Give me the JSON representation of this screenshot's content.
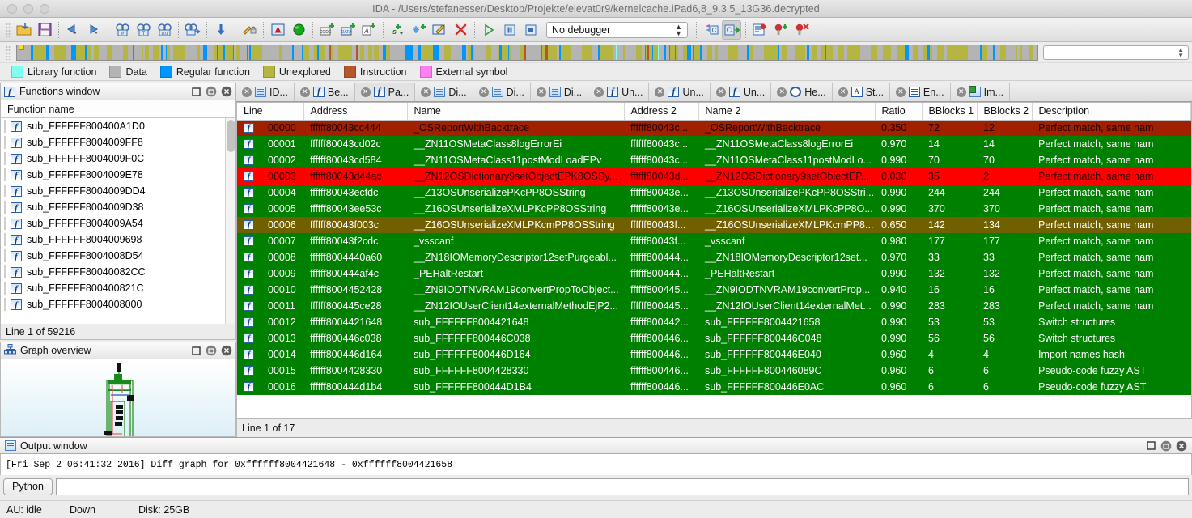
{
  "window": {
    "title": "IDA - /Users/stefanesser/Desktop/Projekte/elevat0r9/kernelcache.iPad6,8_9.3.5_13G36.decrypted"
  },
  "toolbar": {
    "debugger_select": "No debugger",
    "buttons": [
      {
        "name": "open-file-icon"
      },
      {
        "name": "save-icon"
      },
      {
        "name": "navigate-back-icon"
      },
      {
        "name": "navigate-forward-icon"
      },
      {
        "name": "jump-to-address-icon"
      },
      {
        "name": "jump-to-text-icon"
      },
      {
        "name": "jump-to-bytes-icon"
      },
      {
        "name": "jump-to-xref-icon"
      },
      {
        "name": "jump-down-icon"
      },
      {
        "name": "security-lock-icon"
      },
      {
        "name": "warning-icon"
      },
      {
        "name": "green-circle-icon"
      },
      {
        "name": "make-code-icon"
      },
      {
        "name": "make-data-icon"
      },
      {
        "name": "make-string-icon"
      },
      {
        "name": "make-struct-icon"
      },
      {
        "name": "make-unexplored-icon"
      },
      {
        "name": "edit-function-icon"
      },
      {
        "name": "delete-icon"
      },
      {
        "name": "run-icon"
      },
      {
        "name": "pause-icon"
      },
      {
        "name": "stop-icon"
      },
      {
        "name": "decompile-icon"
      },
      {
        "name": "decompile-active-icon"
      },
      {
        "name": "breakpoint-list-icon"
      },
      {
        "name": "add-breakpoint-icon"
      },
      {
        "name": "delete-breakpoint-icon"
      }
    ]
  },
  "navigator": {
    "legend": [
      {
        "label": "Library function",
        "color": "#7ffff0"
      },
      {
        "label": "Data",
        "color": "#b4b4b4"
      },
      {
        "label": "Regular function",
        "color": "#0096ff"
      },
      {
        "label": "Unexplored",
        "color": "#b5b542"
      },
      {
        "label": "Instruction",
        "color": "#b5552a"
      },
      {
        "label": "External symbol",
        "color": "#ff7ff0"
      }
    ]
  },
  "functions_panel": {
    "title": "Functions window",
    "column_header": "Function name",
    "status": "Line 1 of 59216",
    "items": [
      "sub_FFFFFF8004008000",
      "sub_FFFFFF800400821C",
      "sub_FFFFFF80040082CC",
      "sub_FFFFFF8004008D54",
      "sub_FFFFFF8004009698",
      "sub_FFFFFF8004009A54",
      "sub_FFFFFF8004009D38",
      "sub_FFFFFF8004009DD4",
      "sub_FFFFFF8004009E78",
      "sub_FFFFFF8004009F0C",
      "sub_FFFFFF8004009FF8",
      "sub_FFFFFF800400A1D0"
    ]
  },
  "graph_panel": {
    "title": "Graph overview"
  },
  "tabs": [
    {
      "label": "ID...",
      "icon": "document-icon",
      "active": false
    },
    {
      "label": "Be...",
      "icon": "function-icon",
      "active": false
    },
    {
      "label": "Pa...",
      "icon": "function-icon",
      "active": true
    },
    {
      "label": "Di...",
      "icon": "documents-icon",
      "active": false
    },
    {
      "label": "Di...",
      "icon": "documents-icon",
      "active": false
    },
    {
      "label": "Di...",
      "icon": "documents-icon",
      "active": false
    },
    {
      "label": "Un...",
      "icon": "function-icon",
      "active": false
    },
    {
      "label": "Un...",
      "icon": "function-icon",
      "active": false
    },
    {
      "label": "Un...",
      "icon": "function-icon",
      "active": false
    },
    {
      "label": "He...",
      "icon": "hexview-icon",
      "active": false
    },
    {
      "label": "St...",
      "icon": "strings-icon",
      "active": false
    },
    {
      "label": "En...",
      "icon": "enums-icon",
      "active": false
    },
    {
      "label": "Im...",
      "icon": "imports-icon",
      "active": false
    }
  ],
  "diff_table": {
    "columns": [
      "Line",
      "Address",
      "Name",
      "Address 2",
      "Name 2",
      "Ratio",
      "BBlocks 1",
      "BBlocks 2",
      "Description"
    ],
    "status": "Line 1 of 17",
    "rows": [
      {
        "style": "brown",
        "line": "00000",
        "address": "ffffff80043cc444",
        "name": "_OSReportWithBacktrace",
        "address2": "ffffff80043c...",
        "name2": "_OSReportWithBacktrace",
        "ratio": "0.350",
        "bb1": "72",
        "bb2": "12",
        "description": "Perfect match, same nam"
      },
      {
        "style": "green",
        "line": "00001",
        "address": "ffffff80043cd02c",
        "name": "__ZN11OSMetaClass8logErrorEi",
        "address2": "ffffff80043c...",
        "name2": "__ZN11OSMetaClass8logErrorEi",
        "ratio": "0.970",
        "bb1": "14",
        "bb2": "14",
        "description": "Perfect match, same nam"
      },
      {
        "style": "green",
        "line": "00002",
        "address": "ffffff80043cd584",
        "name": "__ZN11OSMetaClass11postModLoadEPv",
        "address2": "ffffff80043c...",
        "name2": "__ZN11OSMetaClass11postModLo...",
        "ratio": "0.990",
        "bb1": "70",
        "bb2": "70",
        "description": "Perfect match, same nam"
      },
      {
        "style": "red",
        "line": "00003",
        "address": "ffffff80043d44ac",
        "name": "__ZN12OSDictionary9setObjectEPK8OSSy...",
        "address2": "ffffff80043d...",
        "name2": "__ZN12OSDictionary9setObjectEP...",
        "ratio": "0.030",
        "bb1": "35",
        "bb2": "2",
        "description": "Perfect match, same nam"
      },
      {
        "style": "green",
        "line": "00004",
        "address": "ffffff80043ecfdc",
        "name": "__Z13OSUnserializePKcPP8OSString",
        "address2": "ffffff80043e...",
        "name2": "__Z13OSUnserializePKcPP8OSStri...",
        "ratio": "0.990",
        "bb1": "244",
        "bb2": "244",
        "description": "Perfect match, same nam"
      },
      {
        "style": "green",
        "line": "00005",
        "address": "ffffff80043ee53c",
        "name": "__Z16OSUnserializeXMLPKcPP8OSString",
        "address2": "ffffff80043e...",
        "name2": "__Z16OSUnserializeXMLPKcPP8O...",
        "ratio": "0.990",
        "bb1": "370",
        "bb2": "370",
        "description": "Perfect match, same nam"
      },
      {
        "style": "olive",
        "line": "00006",
        "address": "ffffff80043f003c",
        "name": "__Z16OSUnserializeXMLPKcmPP8OSString",
        "address2": "ffffff80043f...",
        "name2": "__Z16OSUnserializeXMLPKcmPP8...",
        "ratio": "0.650",
        "bb1": "142",
        "bb2": "134",
        "description": "Perfect match, same nam"
      },
      {
        "style": "green",
        "line": "00007",
        "address": "ffffff80043f2cdc",
        "name": "_vsscanf",
        "address2": "ffffff80043f...",
        "name2": "_vsscanf",
        "ratio": "0.980",
        "bb1": "177",
        "bb2": "177",
        "description": "Perfect match, same nam"
      },
      {
        "style": "green",
        "line": "00008",
        "address": "ffffff8004440a60",
        "name": "__ZN18IOMemoryDescriptor12setPurgeabl...",
        "address2": "ffffff800444...",
        "name2": "__ZN18IOMemoryDescriptor12set...",
        "ratio": "0.970",
        "bb1": "33",
        "bb2": "33",
        "description": "Perfect match, same nam"
      },
      {
        "style": "green",
        "line": "00009",
        "address": "ffffff800444af4c",
        "name": "_PEHaltRestart",
        "address2": "ffffff800444...",
        "name2": "_PEHaltRestart",
        "ratio": "0.990",
        "bb1": "132",
        "bb2": "132",
        "description": "Perfect match, same nam"
      },
      {
        "style": "green",
        "line": "00010",
        "address": "ffffff8004452428",
        "name": "__ZN9IODTNVRAM19convertPropToObject...",
        "address2": "ffffff800445...",
        "name2": "__ZN9IODTNVRAM19convertProp...",
        "ratio": "0.940",
        "bb1": "16",
        "bb2": "16",
        "description": "Perfect match, same nam"
      },
      {
        "style": "green",
        "line": "00011",
        "address": "ffffff800445ce28",
        "name": "__ZN12IOUserClient14externalMethodEjP2...",
        "address2": "ffffff800445...",
        "name2": "__ZN12IOUserClient14externalMet...",
        "ratio": "0.990",
        "bb1": "283",
        "bb2": "283",
        "description": "Perfect match, same nam"
      },
      {
        "style": "green",
        "line": "00012",
        "address": "ffffff8004421648",
        "name": "sub_FFFFFF8004421648",
        "address2": "ffffff800442...",
        "name2": "sub_FFFFFF8004421658",
        "ratio": "0.990",
        "bb1": "53",
        "bb2": "53",
        "description": "Switch structures"
      },
      {
        "style": "green",
        "line": "00013",
        "address": "ffffff800446c038",
        "name": "sub_FFFFFF800446C038",
        "address2": "ffffff800446...",
        "name2": "sub_FFFFFF800446C048",
        "ratio": "0.990",
        "bb1": "56",
        "bb2": "56",
        "description": "Switch structures"
      },
      {
        "style": "green",
        "line": "00014",
        "address": "ffffff800446d164",
        "name": "sub_FFFFFF800446D164",
        "address2": "ffffff800446...",
        "name2": "sub_FFFFFF800446E040",
        "ratio": "0.960",
        "bb1": "4",
        "bb2": "4",
        "description": "Import names hash"
      },
      {
        "style": "green",
        "line": "00015",
        "address": "ffffff8004428330",
        "name": "sub_FFFFFF8004428330",
        "address2": "ffffff800446...",
        "name2": "sub_FFFFFF800446089C",
        "ratio": "0.960",
        "bb1": "6",
        "bb2": "6",
        "description": "Pseudo-code fuzzy AST"
      },
      {
        "style": "green",
        "line": "00016",
        "address": "ffffff800444d1b4",
        "name": "sub_FFFFFF800444D1B4",
        "address2": "ffffff800446...",
        "name2": "sub_FFFFFF800446E0AC",
        "ratio": "0.960",
        "bb1": "6",
        "bb2": "6",
        "description": "Pseudo-code fuzzy AST"
      }
    ]
  },
  "output_window": {
    "title": "Output window",
    "line": "[Fri Sep  2 06:41:32 2016] Diff graph for 0xffffff8004421648 - 0xffffff8004421658",
    "cli_button": "Python",
    "cli_value": ""
  },
  "statusbar": {
    "au": "AU: idle",
    "state": "Down",
    "disk": "Disk: 25GB"
  }
}
